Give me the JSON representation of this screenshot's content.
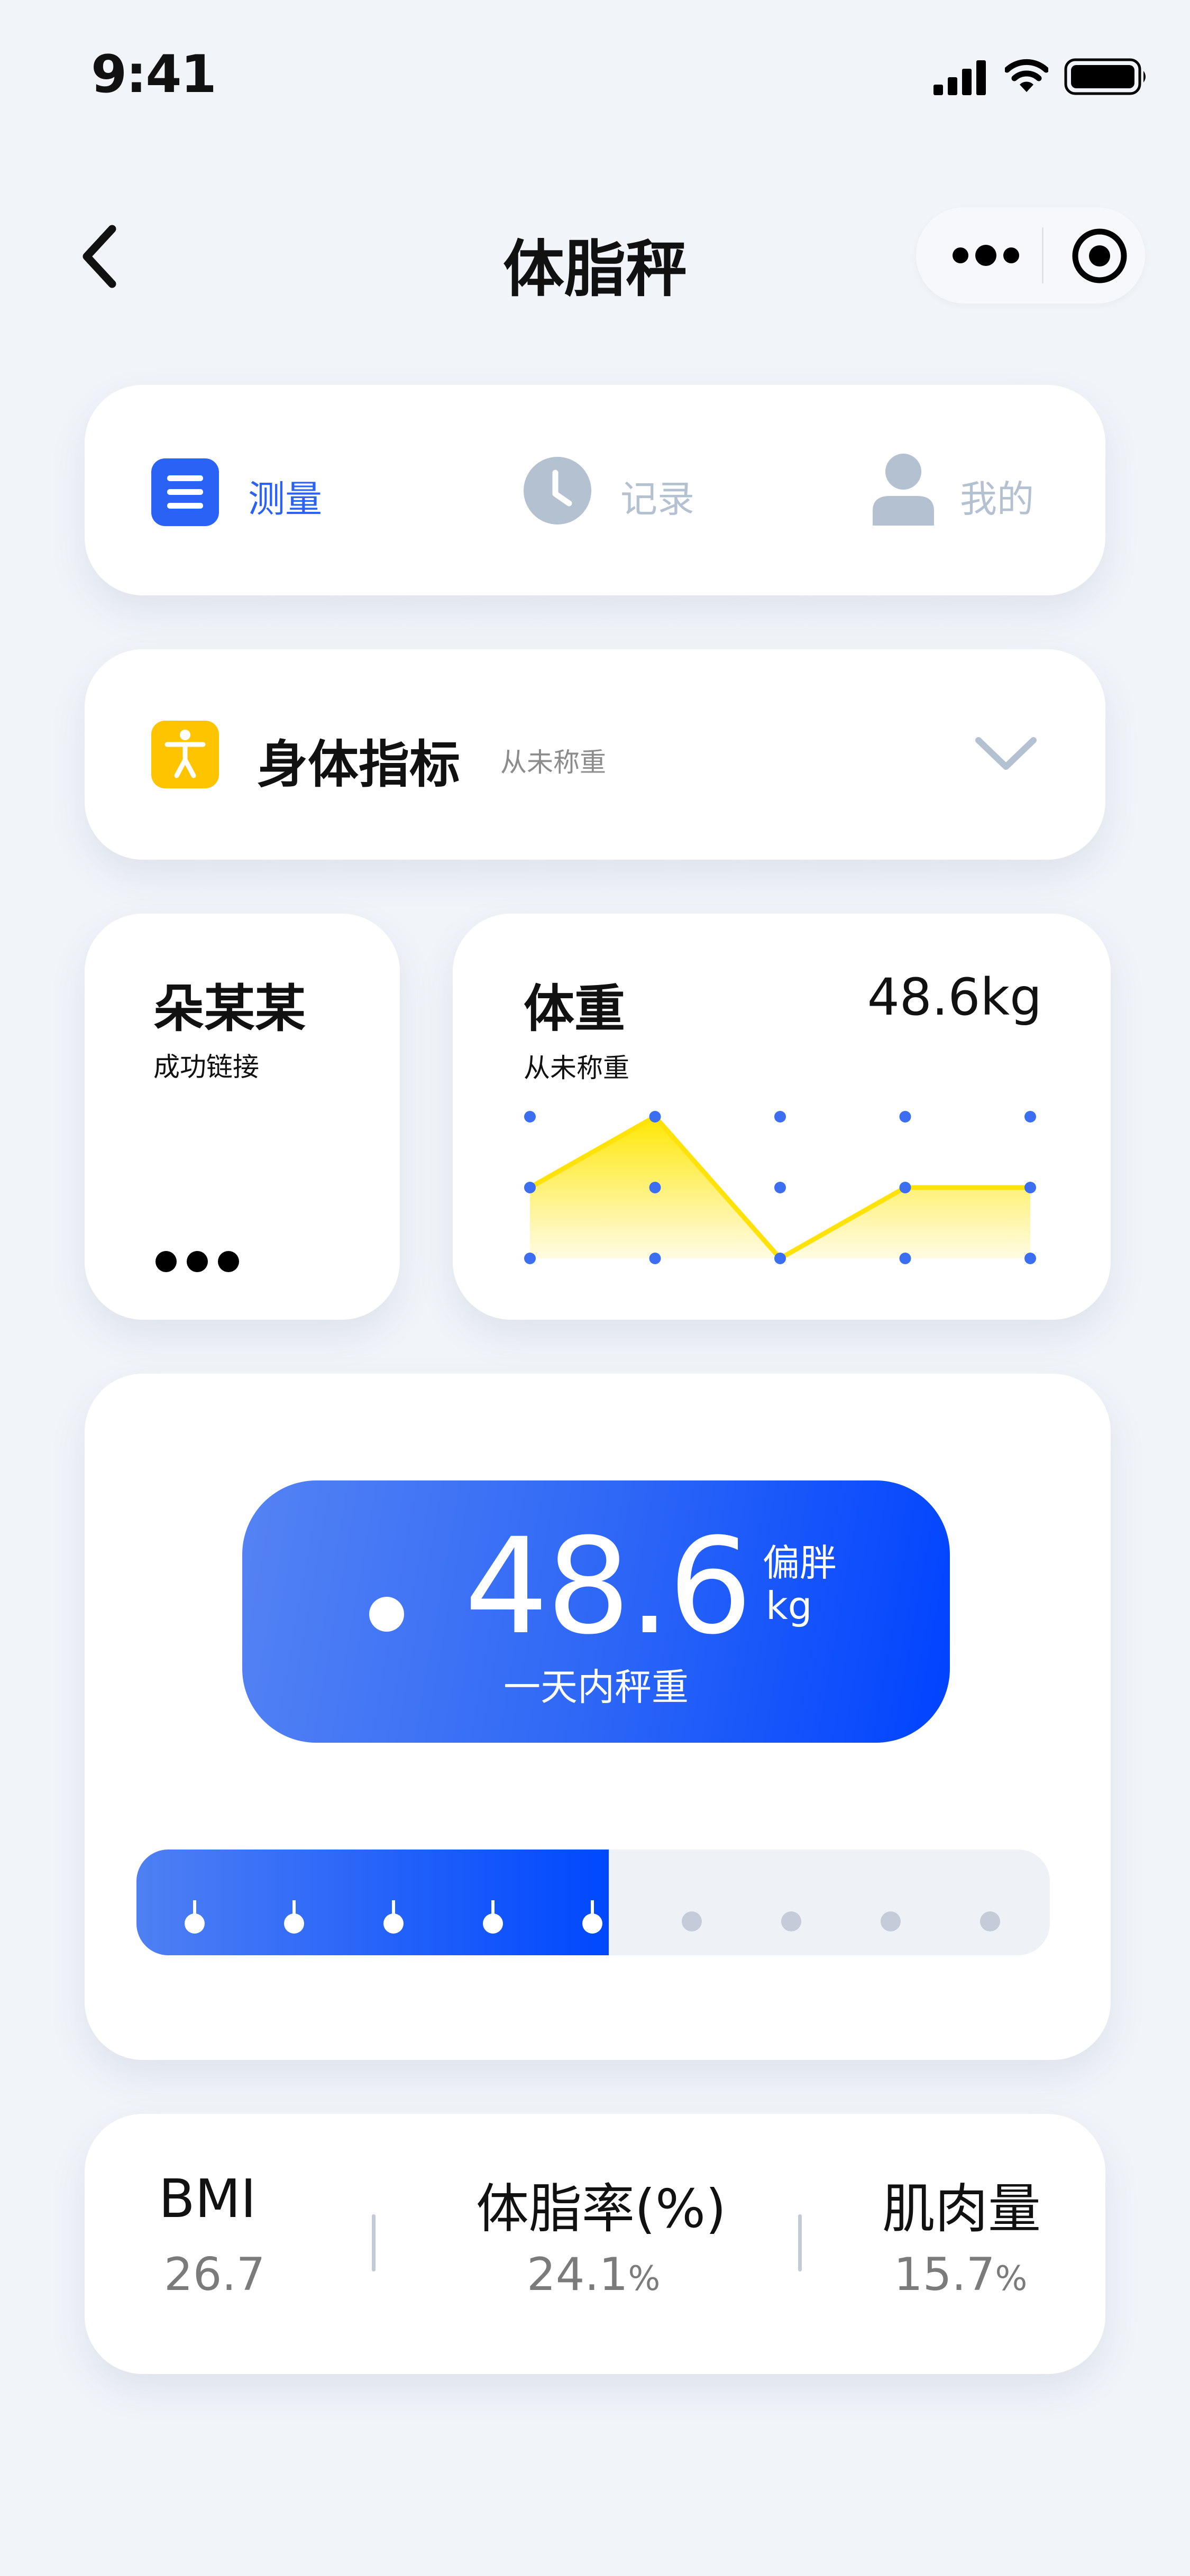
{
  "status_bar": {
    "time": "9:41"
  },
  "nav": {
    "title": "体脂秤"
  },
  "tabs": [
    {
      "label": "测量",
      "active": true,
      "icon": "list-icon"
    },
    {
      "label": "记录",
      "active": false,
      "icon": "clock-icon"
    },
    {
      "label": "我的",
      "active": false,
      "icon": "person-icon"
    }
  ],
  "indicator": {
    "title": "身体指标",
    "subtitle": "从未称重"
  },
  "user_card": {
    "name": "朵某某",
    "status": "成功链接"
  },
  "weight_card": {
    "title": "体重",
    "value": "48.6kg",
    "subtitle": "从未称重"
  },
  "chart_data": {
    "type": "area",
    "title": "",
    "xlabel": "",
    "ylabel": "",
    "x": [
      1,
      2,
      3,
      4,
      5
    ],
    "series": [
      {
        "values": [
          2,
          3,
          1,
          2,
          2
        ]
      }
    ],
    "ylim": [
      1,
      3
    ],
    "grid": "dots",
    "colors": {
      "line": "#ffe20a",
      "fill_top": "#ffe600",
      "fill_bottom": "#fffbe0",
      "dots": "#3b6ef0"
    }
  },
  "result": {
    "value": "48.6",
    "status": "偏胖",
    "unit": "kg",
    "note": "一天内秤重",
    "progress_fraction": 0.517,
    "progress_steps_total": 9,
    "progress_steps_done": 5
  },
  "stats": [
    {
      "label": "BMI",
      "value": "26.7",
      "unit": ""
    },
    {
      "label": "体脂率(%)",
      "value": "24.1",
      "unit": "%"
    },
    {
      "label": "肌肉量",
      "value": "15.7",
      "unit": "%"
    }
  ],
  "colors": {
    "accent": "#2a62f5",
    "yellow": "#ffc400",
    "inactive": "#b4c1d1",
    "background": "#f1f4f9"
  }
}
